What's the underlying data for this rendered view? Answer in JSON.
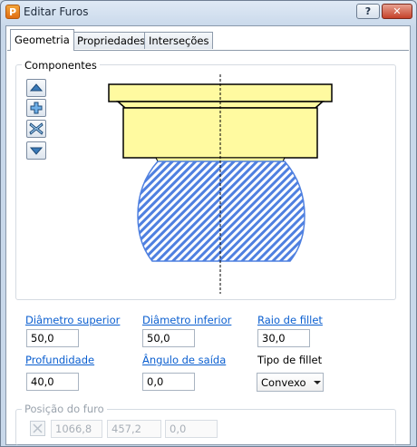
{
  "window": {
    "title": "Editar Furos",
    "app_icon_letter": "P",
    "help_label": "?",
    "close_label": "✕"
  },
  "tabs": [
    {
      "label": "Geometria",
      "active": true
    },
    {
      "label": "Propriedades",
      "active": false
    },
    {
      "label": "Interseções",
      "active": false
    }
  ],
  "components": {
    "group_label": "Componentes",
    "buttons": [
      "arrow-up-icon",
      "plus-icon",
      "delete-x-icon",
      "arrow-down-icon"
    ],
    "colors": {
      "solid": "#fffaa0",
      "hatch": "#4f80e0",
      "outline": "#000000"
    }
  },
  "fields": {
    "diametro_superior": {
      "label": "Diâmetro superior",
      "value": "50,0"
    },
    "diametro_inferior": {
      "label": "Diâmetro inferior",
      "value": "50,0"
    },
    "raio_fillet": {
      "label": "Raio de fillet",
      "value": "30,0"
    },
    "profundidade": {
      "label": "Profundidade",
      "value": "40,0"
    },
    "angulo_saida": {
      "label": "Ângulo de saída",
      "value": "0,0"
    },
    "tipo_fillet": {
      "label": "Tipo de fillet",
      "value": "Convexo"
    }
  },
  "position": {
    "group_label": "Posição do furo",
    "x": "1066,8",
    "y": "457,2",
    "z": "0,0"
  }
}
